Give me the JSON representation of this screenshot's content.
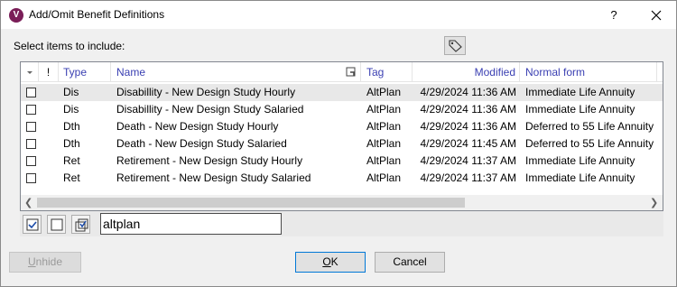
{
  "window": {
    "title": "Add/Omit Benefit Definitions",
    "help_label": "?",
    "app_icon_letter": "V",
    "accent_color": "#7a1e58"
  },
  "select_label": "Select items to include:",
  "grid": {
    "columns": {
      "flag": "!",
      "type": "Type",
      "name": "Name",
      "tag": "Tag",
      "modified": "Modified",
      "normal_form": "Normal form"
    },
    "header_color": "#3a3fb2",
    "rows": [
      {
        "checked": false,
        "type": "Dis",
        "name": "Disabillity - New Design Study Hourly",
        "tag": "AltPlan",
        "modified": "4/29/2024 11:36 AM",
        "normal_form": "Immediate Life Annuity"
      },
      {
        "checked": false,
        "type": "Dis",
        "name": "Disabillity - New Design Study Salaried",
        "tag": "AltPlan",
        "modified": "4/29/2024 11:36 AM",
        "normal_form": "Immediate Life Annuity"
      },
      {
        "checked": false,
        "type": "Dth",
        "name": "Death - New Design Study Hourly",
        "tag": "AltPlan",
        "modified": "4/29/2024 11:36 AM",
        "normal_form": "Deferred to 55 Life Annuity"
      },
      {
        "checked": false,
        "type": "Dth",
        "name": "Death - New Design Study Salaried",
        "tag": "AltPlan",
        "modified": "4/29/2024 11:45 AM",
        "normal_form": "Deferred to 55 Life Annuity"
      },
      {
        "checked": false,
        "type": "Ret",
        "name": "Retirement - New Design Study Hourly",
        "tag": "AltPlan",
        "modified": "4/29/2024 11:37 AM",
        "normal_form": "Immediate Life Annuity"
      },
      {
        "checked": false,
        "type": "Ret",
        "name": "Retirement - New Design Study Salaried",
        "tag": "AltPlan",
        "modified": "4/29/2024 11:37 AM",
        "normal_form": "Immediate Life Annuity"
      }
    ]
  },
  "filter": {
    "value": "altplan"
  },
  "buttons": {
    "unhide_first": "U",
    "unhide_rest": "nhide",
    "ok_first": "O",
    "ok_rest": "K",
    "cancel": "Cancel"
  }
}
